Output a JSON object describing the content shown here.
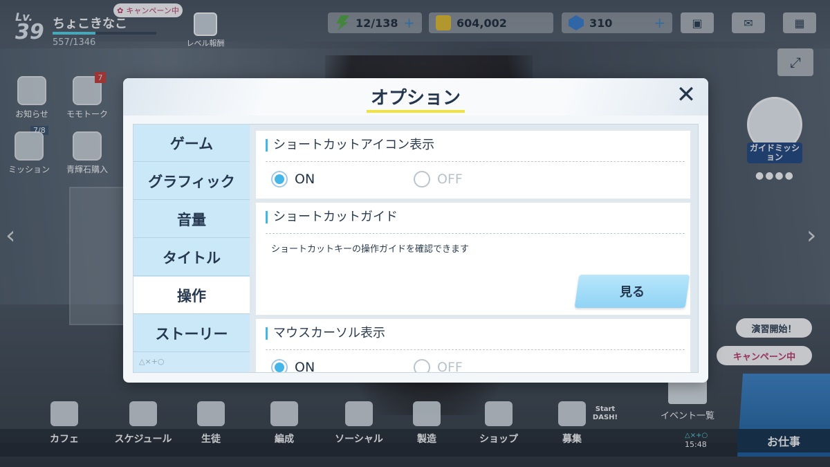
{
  "player": {
    "level_label": "Lv.",
    "level": "39",
    "name": "ちょこきなこ",
    "exp": "557/1346",
    "exp_fraction": 0.41,
    "campaign_tag": "キャンペーン中"
  },
  "level_report": {
    "label": "レベル報酬"
  },
  "resources": {
    "ap": "12/138",
    "credits": "604,002",
    "pyroxene": "310",
    "plus": "+"
  },
  "side_icons": {
    "news": "お知らせ",
    "momotalk": "モモトーク",
    "momotalk_badge": "7",
    "mission": "ミッション",
    "mission_count": "7/8",
    "gem_shop": "青輝石購入"
  },
  "guide_mission": {
    "label": "ガイドミッション"
  },
  "right_pills": {
    "exercise": "演習開始！",
    "campaign": "キャンペーン中"
  },
  "event_list": "イベント一覧",
  "work": "お仕事",
  "bottom_nav": {
    "cafe": "カフェ",
    "schedule": "スケジュール",
    "students": "生徒",
    "formation": "編成",
    "social": "ソーシャル",
    "crafting": "製造",
    "shop": "ショップ",
    "recruit": "募集"
  },
  "start_dash": "Start DASH!",
  "clock": "15:48",
  "controller_symbols": "△×+○",
  "modal": {
    "title": "オプション",
    "close": "✕",
    "tabs": [
      "ゲーム",
      "グラフィック",
      "音量",
      "タイトル",
      "操作",
      "ストーリー"
    ],
    "active_tab": "操作",
    "sections": {
      "shortcut_icon": {
        "title": "ショートカットアイコン表示",
        "on": "ON",
        "off": "OFF",
        "selected": "ON"
      },
      "shortcut_guide": {
        "title": "ショートカットガイド",
        "description": "ショートカットキーの操作ガイドを確認できます",
        "button": "見る"
      },
      "mouse_cursor": {
        "title": "マウスカーソル表示",
        "on": "ON",
        "off": "OFF",
        "selected": "ON"
      }
    }
  }
}
